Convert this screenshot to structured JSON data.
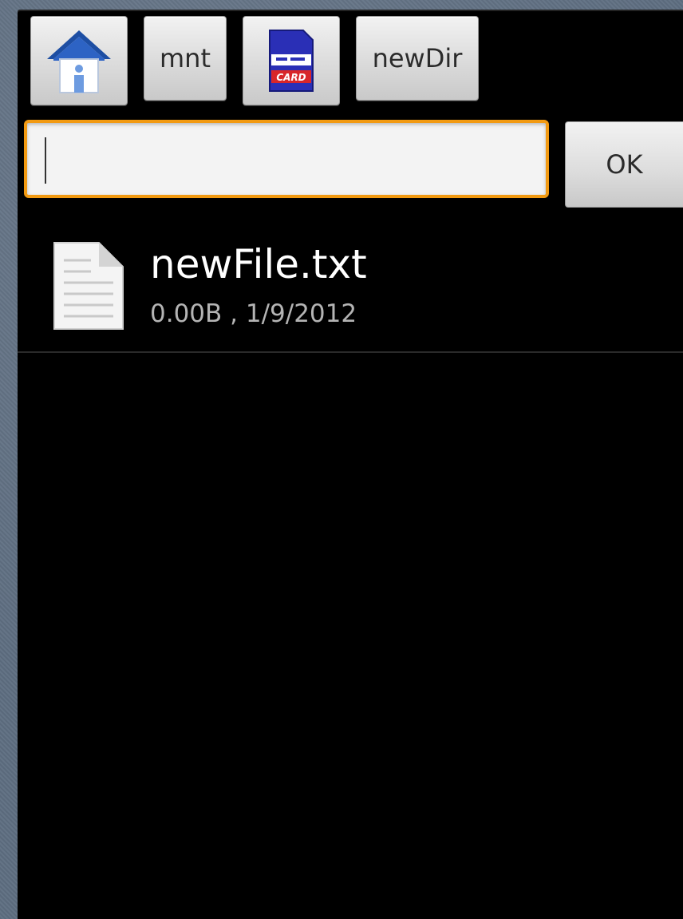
{
  "breadcrumbs": {
    "home_icon": "house-icon",
    "mnt_label": "mnt",
    "sdcard_icon": "sd-card-icon",
    "sdcard_icon_text": "SD CARD",
    "newdir_label": "newDir"
  },
  "path_input": {
    "value": "",
    "placeholder": ""
  },
  "ok_button": {
    "label": "OK"
  },
  "files": [
    {
      "icon": "text-file-icon",
      "name": "newFile.txt",
      "meta": "0.00B , 1/9/2012"
    }
  ],
  "colors": {
    "focus_border": "#f29a12",
    "background": "#000000",
    "sd_card_blue": "#2a2fb6",
    "sd_card_red": "#d8262a",
    "home_blue": "#1d4ea3"
  }
}
